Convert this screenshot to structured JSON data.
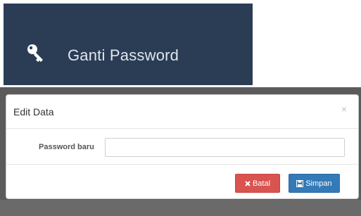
{
  "banner": {
    "icon": "key-icon",
    "label": "Ganti Password"
  },
  "modal": {
    "title": "Edit Data",
    "close_symbol": "×",
    "field_label": "Password baru",
    "field_value": "",
    "field_placeholder": "",
    "cancel_icon": "times-icon",
    "cancel_label": "Batal",
    "save_icon": "floppy-disk-icon",
    "save_label": "Simpan"
  },
  "colors": {
    "banner_bg": "#2b3d55",
    "cancel_button": "#d9534f",
    "save_button": "#337ab7"
  }
}
